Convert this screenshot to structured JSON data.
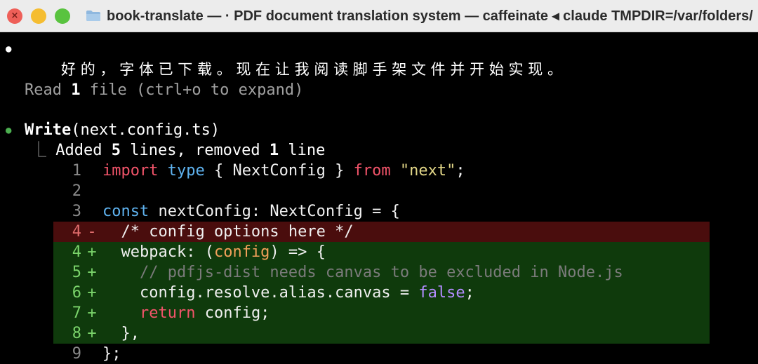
{
  "window": {
    "title": "book-translate — · PDF document translation system — caffeinate ◂ claude TMPDIR=/var/folders/"
  },
  "message": {
    "text": "好的，字体已下载。现在让我阅读脚手架文件并开始实现。"
  },
  "read": {
    "prefix": "Read ",
    "count": "1",
    "suffix": " file (ctrl+o to expand)"
  },
  "write": {
    "tool": "Write",
    "args": "(next.config.ts)",
    "summary_added_label": "Added ",
    "added_count": "5",
    "summary_mid": " lines, removed ",
    "removed_count": "1",
    "summary_end": " line"
  },
  "diff": {
    "l1": {
      "num": "1",
      "t1": "import",
      "t2": "type",
      "t3": " { NextConfig } ",
      "t4": "from",
      "t5": "\"next\"",
      "t6": ";"
    },
    "l2": {
      "num": "2"
    },
    "l3": {
      "num": "3",
      "t1": "const",
      "t2": " nextConfig: NextConfig = {"
    },
    "l4del": {
      "num": "4",
      "mark": "-",
      "text": "  /* config options here */"
    },
    "l4add": {
      "num": "4",
      "mark": "+",
      "t1": "  webpack: (",
      "t2": "config",
      "t3": ") => {"
    },
    "l5": {
      "num": "5",
      "mark": "+",
      "text": "    // pdfjs-dist needs canvas to be excluded in Node.js"
    },
    "l6": {
      "num": "6",
      "mark": "+",
      "t1": "    config.resolve.alias.canvas = ",
      "t2": "false",
      "t3": ";"
    },
    "l7": {
      "num": "7",
      "mark": "+",
      "t1": "    ",
      "t2": "return",
      "t3": " config;"
    },
    "l8": {
      "num": "8",
      "mark": "+",
      "text": "  },"
    },
    "l9": {
      "num": "9",
      "text": "};"
    }
  }
}
